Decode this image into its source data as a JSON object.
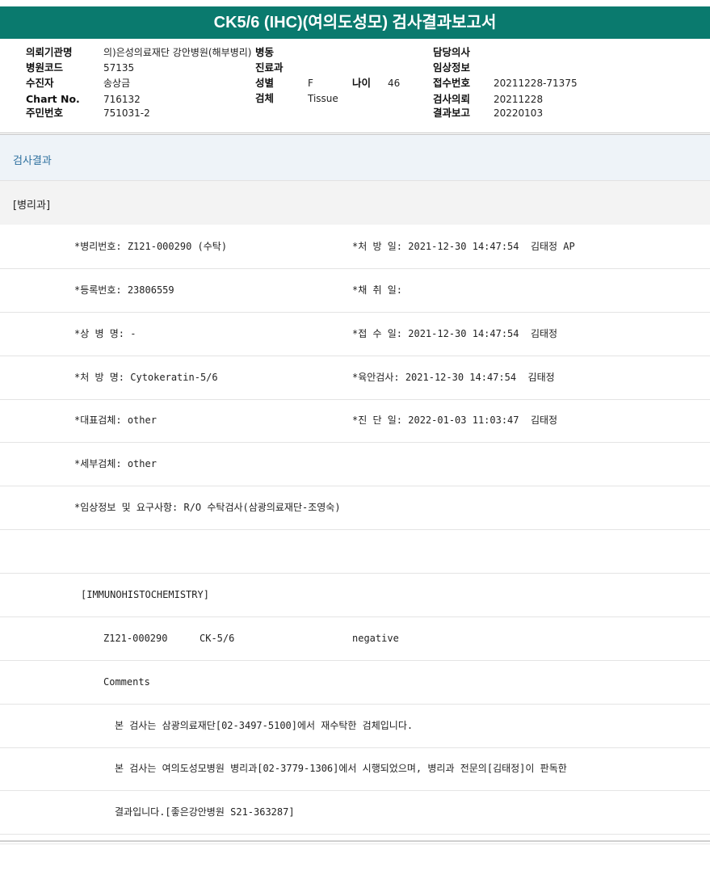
{
  "title": "CK5/6 (IHC)(여의도성모) 검사결과보고서",
  "meta": {
    "institution_label": "의뢰기관명",
    "institution_value": "의)은성의료재단 강안병원(해부병리)",
    "ward_label": "병동",
    "doctor_label": "담당의사",
    "doctor_value": "",
    "hospital_code_label": "병원코드",
    "hospital_code_value": "57135",
    "dept_label": "진료과",
    "dept_value": "",
    "clinical_label": "임상정보",
    "clinical_value": "",
    "patient_label": "수진자",
    "patient_value": "송상금",
    "sex_label": "성별",
    "sex_value": "F",
    "age_label": "나이",
    "age_value": "46",
    "receipt_label": "접수번호",
    "receipt_value": "20211228-71375",
    "chart_label": "Chart No.",
    "chart_value": "716132",
    "specimen_label": "검체",
    "specimen_value": "Tissue",
    "request_label": "검사의뢰",
    "request_value": "20211228",
    "resident_label": "주민번호",
    "resident_value": "751031-2",
    "report_label": "결과보고",
    "report_value": "20220103"
  },
  "sections": {
    "result": "검사결과",
    "dept": "[병리과]"
  },
  "rows": [
    {
      "left": "*병리번호: Z121-000290 (수탁)",
      "right": "*처 방 일: 2021-12-30 14:47:54  김태정 AP"
    },
    {
      "left": "*등록번호: 23806559",
      "right": "*채 취 일:"
    },
    {
      "left": "*상 병 명: -",
      "right": "*접 수 일: 2021-12-30 14:47:54  김태정"
    },
    {
      "left": "*처 방 명: Cytokeratin-5/6",
      "right": "*육안검사: 2021-12-30 14:47:54  김태정"
    },
    {
      "left": "*대표검체: other",
      "right": "*진 단 일: 2022-01-03 11:03:47  김태정"
    },
    {
      "left": "*세부검체: other",
      "right": ""
    },
    {
      "left": "*임상정보 및 요구사항: R/O 수탁검사(삼광의료재단-조영숙)",
      "right": ""
    }
  ],
  "ihc": {
    "header": "[IMMUNOHISTOCHEMISTRY]",
    "case_no": "Z121-000290",
    "marker": "CK-5/6",
    "result": "negative",
    "comments_label": "Comments",
    "comment_1": "본 검사는 삼광의료재단[02-3497-5100]에서 재수탁한 검체입니다.",
    "comment_2": "본 검사는 여의도성모병원 병리과[02-3779-1306]에서 시행되었으며, 병리과 전문의[김태정]이 판독한",
    "comment_3": "결과입니다.[좋은강안병원 S21-363287]"
  }
}
